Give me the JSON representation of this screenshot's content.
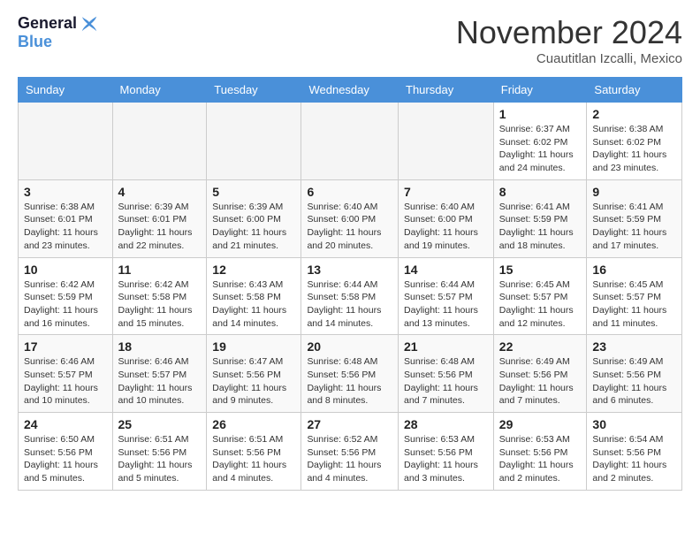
{
  "header": {
    "logo_line1": "General",
    "logo_line2": "Blue",
    "month_title": "November 2024",
    "subtitle": "Cuautitlan Izcalli, Mexico"
  },
  "weekdays": [
    "Sunday",
    "Monday",
    "Tuesday",
    "Wednesday",
    "Thursday",
    "Friday",
    "Saturday"
  ],
  "weeks": [
    [
      {
        "day": "",
        "info": ""
      },
      {
        "day": "",
        "info": ""
      },
      {
        "day": "",
        "info": ""
      },
      {
        "day": "",
        "info": ""
      },
      {
        "day": "",
        "info": ""
      },
      {
        "day": "1",
        "info": "Sunrise: 6:37 AM\nSunset: 6:02 PM\nDaylight: 11 hours and 24 minutes."
      },
      {
        "day": "2",
        "info": "Sunrise: 6:38 AM\nSunset: 6:02 PM\nDaylight: 11 hours and 23 minutes."
      }
    ],
    [
      {
        "day": "3",
        "info": "Sunrise: 6:38 AM\nSunset: 6:01 PM\nDaylight: 11 hours and 23 minutes."
      },
      {
        "day": "4",
        "info": "Sunrise: 6:39 AM\nSunset: 6:01 PM\nDaylight: 11 hours and 22 minutes."
      },
      {
        "day": "5",
        "info": "Sunrise: 6:39 AM\nSunset: 6:00 PM\nDaylight: 11 hours and 21 minutes."
      },
      {
        "day": "6",
        "info": "Sunrise: 6:40 AM\nSunset: 6:00 PM\nDaylight: 11 hours and 20 minutes."
      },
      {
        "day": "7",
        "info": "Sunrise: 6:40 AM\nSunset: 6:00 PM\nDaylight: 11 hours and 19 minutes."
      },
      {
        "day": "8",
        "info": "Sunrise: 6:41 AM\nSunset: 5:59 PM\nDaylight: 11 hours and 18 minutes."
      },
      {
        "day": "9",
        "info": "Sunrise: 6:41 AM\nSunset: 5:59 PM\nDaylight: 11 hours and 17 minutes."
      }
    ],
    [
      {
        "day": "10",
        "info": "Sunrise: 6:42 AM\nSunset: 5:59 PM\nDaylight: 11 hours and 16 minutes."
      },
      {
        "day": "11",
        "info": "Sunrise: 6:42 AM\nSunset: 5:58 PM\nDaylight: 11 hours and 15 minutes."
      },
      {
        "day": "12",
        "info": "Sunrise: 6:43 AM\nSunset: 5:58 PM\nDaylight: 11 hours and 14 minutes."
      },
      {
        "day": "13",
        "info": "Sunrise: 6:44 AM\nSunset: 5:58 PM\nDaylight: 11 hours and 14 minutes."
      },
      {
        "day": "14",
        "info": "Sunrise: 6:44 AM\nSunset: 5:57 PM\nDaylight: 11 hours and 13 minutes."
      },
      {
        "day": "15",
        "info": "Sunrise: 6:45 AM\nSunset: 5:57 PM\nDaylight: 11 hours and 12 minutes."
      },
      {
        "day": "16",
        "info": "Sunrise: 6:45 AM\nSunset: 5:57 PM\nDaylight: 11 hours and 11 minutes."
      }
    ],
    [
      {
        "day": "17",
        "info": "Sunrise: 6:46 AM\nSunset: 5:57 PM\nDaylight: 11 hours and 10 minutes."
      },
      {
        "day": "18",
        "info": "Sunrise: 6:46 AM\nSunset: 5:57 PM\nDaylight: 11 hours and 10 minutes."
      },
      {
        "day": "19",
        "info": "Sunrise: 6:47 AM\nSunset: 5:56 PM\nDaylight: 11 hours and 9 minutes."
      },
      {
        "day": "20",
        "info": "Sunrise: 6:48 AM\nSunset: 5:56 PM\nDaylight: 11 hours and 8 minutes."
      },
      {
        "day": "21",
        "info": "Sunrise: 6:48 AM\nSunset: 5:56 PM\nDaylight: 11 hours and 7 minutes."
      },
      {
        "day": "22",
        "info": "Sunrise: 6:49 AM\nSunset: 5:56 PM\nDaylight: 11 hours and 7 minutes."
      },
      {
        "day": "23",
        "info": "Sunrise: 6:49 AM\nSunset: 5:56 PM\nDaylight: 11 hours and 6 minutes."
      }
    ],
    [
      {
        "day": "24",
        "info": "Sunrise: 6:50 AM\nSunset: 5:56 PM\nDaylight: 11 hours and 5 minutes."
      },
      {
        "day": "25",
        "info": "Sunrise: 6:51 AM\nSunset: 5:56 PM\nDaylight: 11 hours and 5 minutes."
      },
      {
        "day": "26",
        "info": "Sunrise: 6:51 AM\nSunset: 5:56 PM\nDaylight: 11 hours and 4 minutes."
      },
      {
        "day": "27",
        "info": "Sunrise: 6:52 AM\nSunset: 5:56 PM\nDaylight: 11 hours and 4 minutes."
      },
      {
        "day": "28",
        "info": "Sunrise: 6:53 AM\nSunset: 5:56 PM\nDaylight: 11 hours and 3 minutes."
      },
      {
        "day": "29",
        "info": "Sunrise: 6:53 AM\nSunset: 5:56 PM\nDaylight: 11 hours and 2 minutes."
      },
      {
        "day": "30",
        "info": "Sunrise: 6:54 AM\nSunset: 5:56 PM\nDaylight: 11 hours and 2 minutes."
      }
    ]
  ]
}
